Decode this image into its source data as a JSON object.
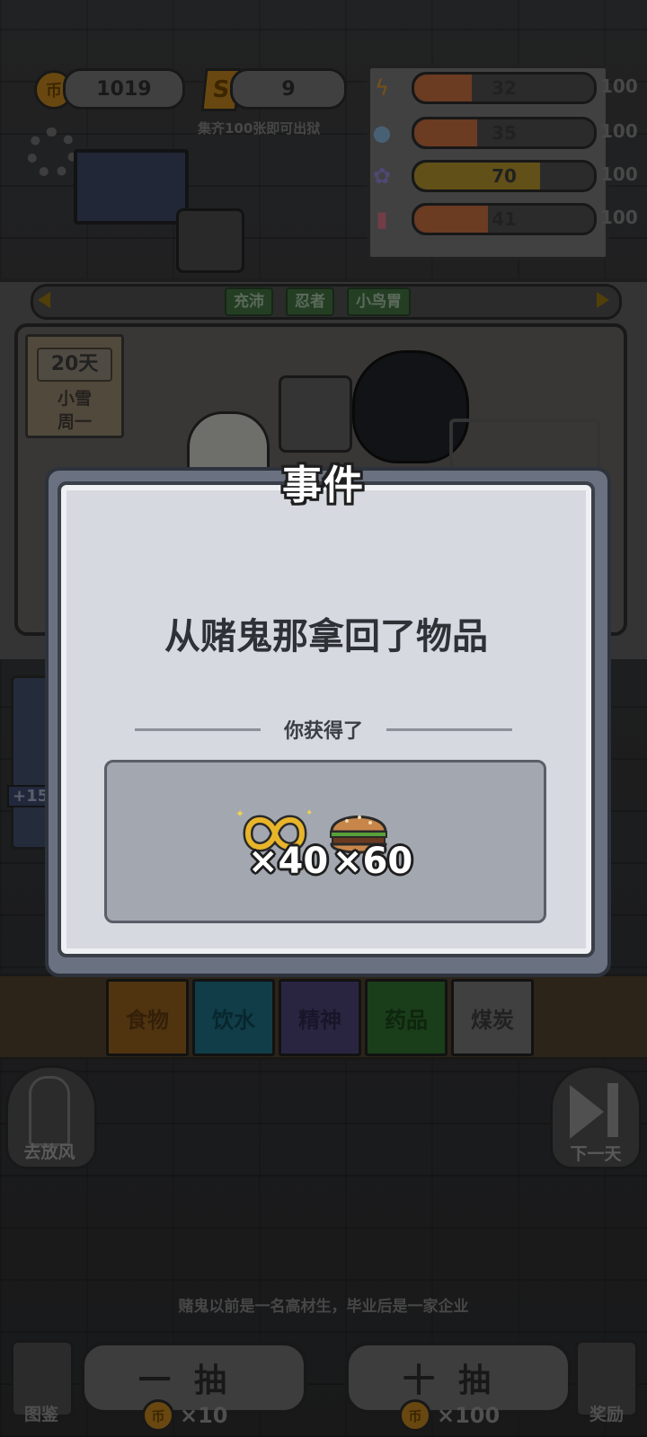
{
  "top_bar": {
    "coins": "1019",
    "tickets": "9",
    "ticket_icon": "S",
    "coin_icon": "币",
    "collect_hint": "集齐100张即可出狱"
  },
  "stats": [
    {
      "icon": "lightning-icon",
      "glyph": "ϟ",
      "value": "32",
      "max": "100",
      "fraction": 0.32,
      "color": "#b9673b"
    },
    {
      "icon": "water-drop-icon",
      "glyph": "●",
      "value": "35",
      "max": "100",
      "fraction": 0.35,
      "color": "#b9673b"
    },
    {
      "icon": "brain-icon",
      "glyph": "✿",
      "value": "70",
      "max": "100",
      "fraction": 0.7,
      "color": "#a88a2a"
    },
    {
      "icon": "thermometer-icon",
      "glyph": "▮",
      "value": "41",
      "max": "100",
      "fraction": 0.41,
      "color": "#b9673b"
    }
  ],
  "traits": [
    "充沛",
    "忍者",
    "小鸟胃"
  ],
  "day_card": {
    "day": "20天",
    "weather": "小雪",
    "weekday": "周一"
  },
  "side_tag": "+15",
  "categories": [
    {
      "label": "食物",
      "color": "#8a5a1c",
      "text": "#5a3810"
    },
    {
      "label": "饮水",
      "color": "#1d6a7a",
      "text": "#0f4350"
    },
    {
      "label": "精神",
      "color": "#48406e",
      "text": "#2c2548"
    },
    {
      "label": "药品",
      "color": "#2d6a2e",
      "text": "#194019"
    },
    {
      "label": "煤炭",
      "color": "#6e6e6e",
      "text": "#3a3a3a"
    }
  ],
  "left_button": {
    "label": "去放风"
  },
  "right_button": {
    "label": "下一天"
  },
  "story_text": "赌鬼以前是一名高材生，毕业后是一家企业",
  "draw_one": {
    "label": "一抽",
    "cost": "×10"
  },
  "draw_ten": {
    "label": "十抽",
    "cost": "×100"
  },
  "codex": {
    "label": "图鉴"
  },
  "rewards_btn": {
    "label": "奖励"
  },
  "modal": {
    "title": "事件",
    "message": "从赌鬼那拿回了物品",
    "subtitle": "你获得了",
    "rewards": [
      {
        "icon": "infinity-ring-icon",
        "qty": "×40"
      },
      {
        "icon": "burger-icon",
        "qty": "×60"
      }
    ]
  }
}
